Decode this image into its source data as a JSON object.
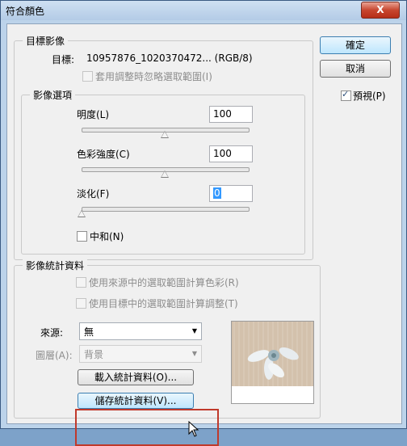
{
  "window": {
    "title": "符合顏色",
    "close_label": "X"
  },
  "buttons": {
    "ok": "確定",
    "cancel": "取消",
    "load_stats": "載入統計資料(O)...",
    "save_stats": "儲存統計資料(V)..."
  },
  "preview": {
    "label": "預視(P)",
    "checked": true
  },
  "target": {
    "legend": "目標影像",
    "label": "目標:",
    "value": "10957876_1020370472... (RGB/8)",
    "ignore_selection": "套用調整時忽略選取範圍(I)"
  },
  "options": {
    "legend": "影像選項",
    "luminance": {
      "label": "明度(L)",
      "value": "100",
      "level": 100,
      "max": 200
    },
    "color_intensity": {
      "label": "色彩強度(C)",
      "value": "100",
      "level": 100,
      "max": 200
    },
    "fade": {
      "label": "淡化(F)",
      "value": "0",
      "level": 0,
      "max": 100
    },
    "neutralize": "中和(N)"
  },
  "stats": {
    "legend": "影像統計資料",
    "use_source_selection": "使用來源中的選取範圍計算色彩(R)",
    "use_target_selection": "使用目標中的選取範圍計算調整(T)",
    "source_label": "來源:",
    "source_value": "無",
    "layer_label": "圖層(A):",
    "layer_value": "背景"
  },
  "colors": {
    "titlebar": "#b3cbe6",
    "client": "#f0f0f0",
    "highlight": "#c0392b",
    "close": "#c7462f"
  },
  "icons": {
    "close": "close-icon",
    "cursor": "mouse-pointer-icon",
    "dropdown": "chevron-down-icon"
  }
}
